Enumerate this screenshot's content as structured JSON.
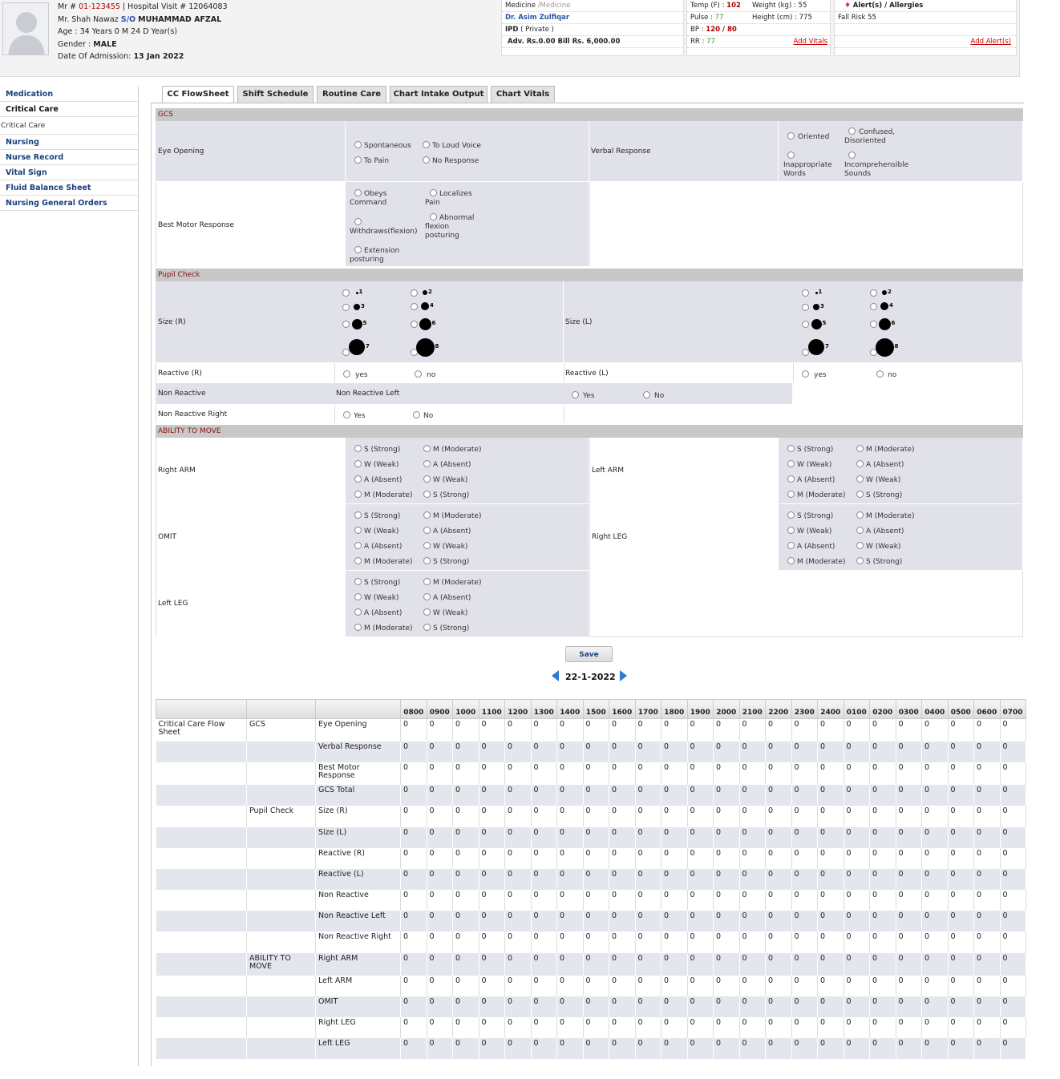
{
  "patient": {
    "mr_label": "Mr #",
    "mr_no": "01-123455",
    "visit_text": "| Hospital Visit # 12064083",
    "father": "Mr. Shah Nawaz",
    "so": "S/O",
    "name": "MUHAMMAD AFZAL",
    "age": "Age : 34 Years 0 M 24 D Year(s)",
    "gender_label": "Gender :",
    "gender": "MALE",
    "doa_label": "Date Of Admission:",
    "doa": "13 Jan 2022"
  },
  "dept": {
    "dept": "Medicine",
    "sub": "/Medicine",
    "doctor": "Dr. Asim Zulfiqar",
    "ipd": "IPD",
    "type": "( Private )",
    "bill": "Adv. Rs.0.00 Bill Rs. 6,000.00"
  },
  "vitals": {
    "temp_label": "Temp (F) :",
    "temp": "102",
    "weight": "Weight (kg) : 55",
    "pulse_label": "Pulse :",
    "pulse": "77",
    "height": "Height (cm) : 775",
    "bp_label": "BP :",
    "bp": "120 / 80",
    "rr_label": "RR :",
    "rr": "77",
    "add": "Add Vitals"
  },
  "alerts": {
    "title": "Alert(s) / Allergies",
    "fall": "Fall Risk 55",
    "add": "Add Alert(s)"
  },
  "sidebar": [
    {
      "label": "Medication"
    },
    {
      "label": "Critical Care"
    },
    {
      "label": "Critical Care"
    },
    {
      "label": "Nursing"
    },
    {
      "label": "Nurse Record"
    },
    {
      "label": "Vital Sign"
    },
    {
      "label": "Fluid Balance Sheet"
    },
    {
      "label": "Nursing General Orders"
    }
  ],
  "tabs": [
    "CC FlowSheet",
    "Shift Schedule",
    "Routine Care",
    "Chart Intake Output",
    "Chart Vitals"
  ],
  "form": {
    "gcs": "GCS",
    "eye": "Eye Opening",
    "eye_opts": [
      "Spontaneous",
      "To Loud Voice",
      "To Pain",
      "No Response"
    ],
    "verbal": "Verbal Response",
    "verbal_opts": [
      "Oriented",
      "Confused, Disoriented",
      "Inappropriate Words",
      "Incomprehensible Sounds"
    ],
    "motor": "Best Motor Response",
    "motor_opts": [
      "Obeys Command",
      "Localizes Pain",
      "Withdraws(flexion)",
      "Abnormal flexion posturing",
      "Extension posturing"
    ],
    "pupil": "Pupil Check",
    "size_r": "Size (R)",
    "size_l": "Size (L)",
    "sizes": [
      "1",
      "2",
      "3",
      "4",
      "5",
      "6",
      "7",
      "8"
    ],
    "reactive_r": "Reactive (R)",
    "reactive_l": "Reactive (L)",
    "yes": "yes",
    "no": "no",
    "non_reactive": "Non Reactive",
    "non_reactive_left": "Non Reactive Left",
    "non_reactive_right": "Non Reactive Right",
    "Yes": "Yes",
    "No": "No",
    "ability": "ABILITY TO MOVE",
    "right_arm": "Right ARM",
    "left_arm": "Left ARM",
    "omit": "OMIT",
    "right_leg": "Right LEG",
    "left_leg": "Left LEG",
    "strength_opts": [
      "S (Strong)",
      "M (Moderate)",
      "W (Weak)",
      "A (Absent)",
      "A (Absent)",
      "W (Weak)",
      "M (Moderate)",
      "S (Strong)"
    ],
    "save": "Save",
    "date": "22-1-2022"
  },
  "grid": {
    "hours": [
      "0800",
      "0900",
      "1000",
      "1100",
      "1200",
      "1300",
      "1400",
      "1500",
      "1600",
      "1700",
      "1800",
      "1900",
      "2000",
      "2100",
      "2200",
      "2300",
      "2400",
      "0100",
      "0200",
      "0300",
      "0400",
      "0500",
      "0600",
      "0700"
    ],
    "rows": [
      {
        "c1": "Critical Care Flow Sheet",
        "c2": "GCS",
        "c3": "Eye Opening"
      },
      {
        "c1": "",
        "c2": "",
        "c3": "Verbal Response"
      },
      {
        "c1": "",
        "c2": "",
        "c3": "Best Motor Response"
      },
      {
        "c1": "",
        "c2": "",
        "c3": "GCS Total"
      },
      {
        "c1": "",
        "c2": "Pupil Check",
        "c3": "Size (R)"
      },
      {
        "c1": "",
        "c2": "",
        "c3": "Size (L)"
      },
      {
        "c1": "",
        "c2": "",
        "c3": "Reactive (R)"
      },
      {
        "c1": "",
        "c2": "",
        "c3": "Reactive (L)"
      },
      {
        "c1": "",
        "c2": "",
        "c3": "Non Reactive"
      },
      {
        "c1": "",
        "c2": "",
        "c3": "Non Reactive Left"
      },
      {
        "c1": "",
        "c2": "",
        "c3": "Non Reactive Right"
      },
      {
        "c1": "",
        "c2": "ABILITY TO MOVE",
        "c3": "Right ARM"
      },
      {
        "c1": "",
        "c2": "",
        "c3": "Left ARM"
      },
      {
        "c1": "",
        "c2": "",
        "c3": "OMIT"
      },
      {
        "c1": "",
        "c2": "",
        "c3": "Right LEG"
      },
      {
        "c1": "",
        "c2": "",
        "c3": "Left LEG"
      }
    ],
    "value": "0"
  }
}
